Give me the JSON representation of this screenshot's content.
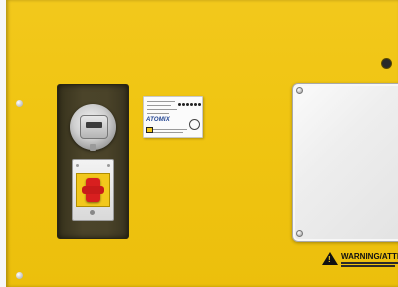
{
  "scene": {
    "description_colors": {
      "panel": "#f0c512",
      "recess": "#4a4329",
      "switch_knob": "#d81f1f",
      "door": "#eeeeee",
      "nameplate_brand": "#1c3f8e"
    }
  },
  "nameplate": {
    "brand": "ATOMIX"
  },
  "warning_label": {
    "icon": "warning-triangle-icon",
    "glyph": "!",
    "title": "WARNING/ATTEN"
  }
}
